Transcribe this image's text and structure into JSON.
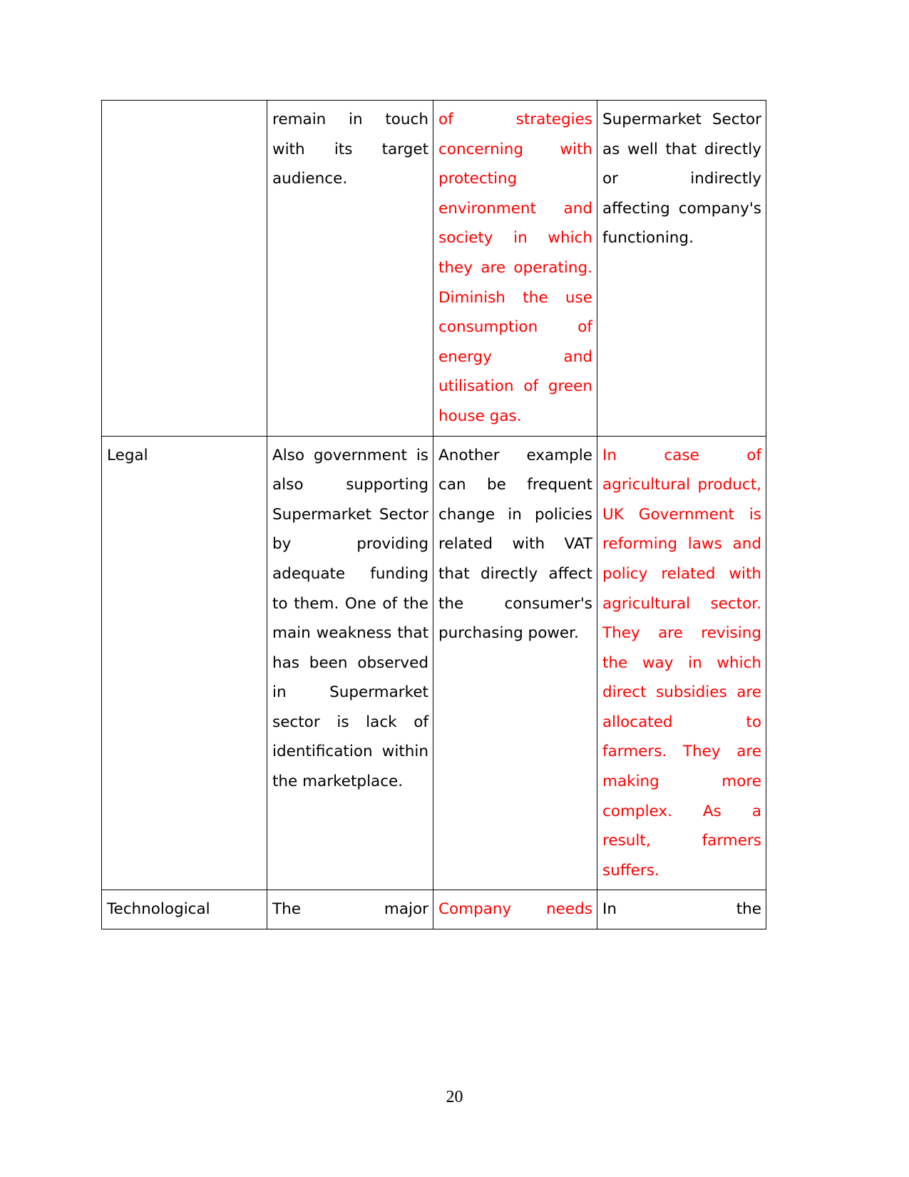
{
  "document": {
    "page_number": "20",
    "colors": {
      "text": "#000000",
      "highlight_red": "#FF0000",
      "border": "#000000"
    }
  },
  "table": {
    "name": "pestle-analysis-table",
    "rows": [
      {
        "factor": "",
        "col2": "remain in touch with its target audience.",
        "col3": "of strategies concerning with protecting environment and society in which they are operating. Diminish the use consumption of energy and utilisation of green house gas.",
        "col3_color": "#FF0000",
        "col4": "Supermarket Sector as well that directly or indirectly affecting company's functioning.",
        "col4_color": "#000000"
      },
      {
        "factor": "Legal",
        "col2": " Also government is also supporting Supermarket Sector by providing adequate funding to them.  One of the main weakness that has been observed in Supermarket sector is lack of identification within the marketplace.",
        "col3": " Another example can be frequent change in policies related with VAT that directly affect the consumer's purchasing power.",
        "col3_color": "#000000",
        "col4": "In case of agricultural product, UK Government is reforming laws and policy related with agricultural sector. They are revising the way in which direct subsidies are allocated to farmers. They are making more complex. As a result, farmers suffers.",
        "col4_color": "#FF0000"
      },
      {
        "factor": "Technological",
        "col2": "The major",
        "col3": "Company needs",
        "col3_color": "#FF0000",
        "col4": "In the",
        "col4_color": "#000000"
      }
    ]
  }
}
